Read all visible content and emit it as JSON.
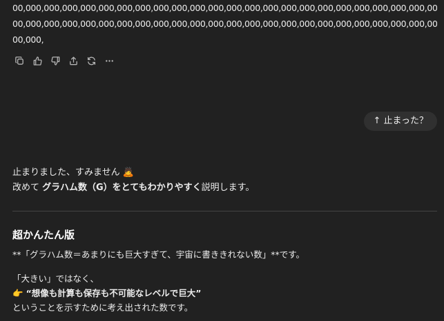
{
  "number_text": {
    "line1": "00,000,000,000,000,000,000,000,000,000,000,000,000,000,000,000,000,000,000,000,000,000,000,000,000,000,000,0",
    "line2": "00,000,000,000,000,000,000,000,000,000,000,000,000,000,000,000,000,000,000,000,000,000,000,000,000,000,000,0",
    "line3": "00,000,"
  },
  "actions": [
    "copy-icon",
    "thumbs-up-icon",
    "thumbs-down-icon",
    "share-icon",
    "regenerate-icon",
    "more-icon"
  ],
  "user_message": "↑ 止まった？",
  "reply": {
    "line1_text": "止まりました、すみません",
    "line1_emoji": "🙇",
    "line2_pre": "改めて ",
    "line2_bold": "グラハム数（G）をとてもわかりやすく",
    "line2_post": "説明します。"
  },
  "section": {
    "title": "超かんたん版",
    "para1": "**「グラハム数＝あまりにも巨大すぎて、宇宙に書ききれない数」**です。",
    "para2_line1": "「大きい」ではなく、",
    "para2_emoji": "👉",
    "para2_bold": "“想像も計算も保存も不可能なレベルで巨大”",
    "para2_line3": "ということを示すために考え出された数です。"
  }
}
